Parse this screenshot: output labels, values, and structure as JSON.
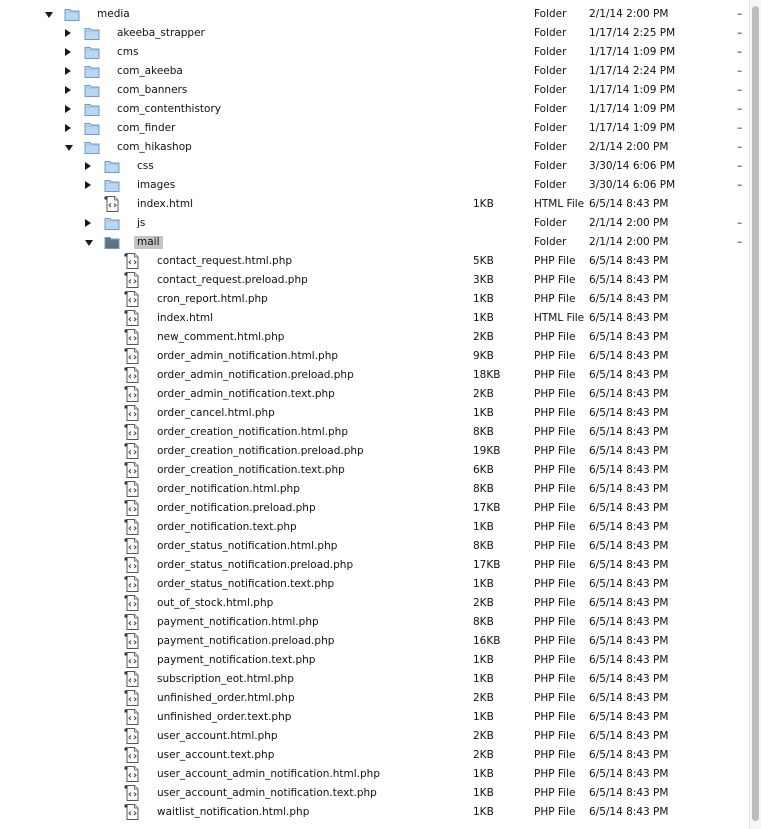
{
  "rows": [
    {
      "depth": 0,
      "disclosure": "open",
      "icon": "folder-icon",
      "name": "media",
      "size": "",
      "kind": "Folder",
      "date": "2/1/14 2:00 PM",
      "extra": "–"
    },
    {
      "depth": 1,
      "disclosure": "closed",
      "icon": "folder-icon",
      "name": "akeeba_strapper",
      "size": "",
      "kind": "Folder",
      "date": "1/17/14 2:25 PM",
      "extra": "–"
    },
    {
      "depth": 1,
      "disclosure": "closed",
      "icon": "folder-icon",
      "name": "cms",
      "size": "",
      "kind": "Folder",
      "date": "1/17/14 1:09 PM",
      "extra": "–"
    },
    {
      "depth": 1,
      "disclosure": "closed",
      "icon": "folder-icon",
      "name": "com_akeeba",
      "size": "",
      "kind": "Folder",
      "date": "1/17/14 2:24 PM",
      "extra": "–"
    },
    {
      "depth": 1,
      "disclosure": "closed",
      "icon": "folder-icon",
      "name": "com_banners",
      "size": "",
      "kind": "Folder",
      "date": "1/17/14 1:09 PM",
      "extra": "–"
    },
    {
      "depth": 1,
      "disclosure": "closed",
      "icon": "folder-icon",
      "name": "com_contenthistory",
      "size": "",
      "kind": "Folder",
      "date": "1/17/14 1:09 PM",
      "extra": "–"
    },
    {
      "depth": 1,
      "disclosure": "closed",
      "icon": "folder-icon",
      "name": "com_finder",
      "size": "",
      "kind": "Folder",
      "date": "1/17/14 1:09 PM",
      "extra": "–"
    },
    {
      "depth": 1,
      "disclosure": "open",
      "icon": "folder-icon",
      "name": "com_hikashop",
      "size": "",
      "kind": "Folder",
      "date": "2/1/14 2:00 PM",
      "extra": "–"
    },
    {
      "depth": 2,
      "disclosure": "closed",
      "icon": "folder-icon",
      "name": "css",
      "size": "",
      "kind": "Folder",
      "date": "3/30/14 6:06 PM",
      "extra": "–"
    },
    {
      "depth": 2,
      "disclosure": "closed",
      "icon": "folder-icon",
      "name": "images",
      "size": "",
      "kind": "Folder",
      "date": "3/30/14 6:06 PM",
      "extra": "–"
    },
    {
      "depth": 2,
      "disclosure": "none",
      "icon": "html-file-icon",
      "name": "index.html",
      "size": "1KB",
      "kind": "HTML File",
      "date": "6/5/14 8:43 PM",
      "extra": ""
    },
    {
      "depth": 2,
      "disclosure": "closed",
      "icon": "folder-icon",
      "name": "js",
      "size": "",
      "kind": "Folder",
      "date": "2/1/14 2:00 PM",
      "extra": "–"
    },
    {
      "depth": 2,
      "disclosure": "open",
      "icon": "folder-selected-icon",
      "name": "mail",
      "size": "",
      "kind": "Folder",
      "date": "2/1/14 2:00 PM",
      "extra": "–",
      "selected": true
    },
    {
      "depth": 3,
      "disclosure": "none",
      "icon": "php-file-icon",
      "name": "contact_request.html.php",
      "size": "5KB",
      "kind": "PHP File",
      "date": "6/5/14 8:43 PM",
      "extra": ""
    },
    {
      "depth": 3,
      "disclosure": "none",
      "icon": "php-file-icon",
      "name": "contact_request.preload.php",
      "size": "3KB",
      "kind": "PHP File",
      "date": "6/5/14 8:43 PM",
      "extra": ""
    },
    {
      "depth": 3,
      "disclosure": "none",
      "icon": "php-file-icon",
      "name": "cron_report.html.php",
      "size": "1KB",
      "kind": "PHP File",
      "date": "6/5/14 8:43 PM",
      "extra": ""
    },
    {
      "depth": 3,
      "disclosure": "none",
      "icon": "html-file-icon",
      "name": "index.html",
      "size": "1KB",
      "kind": "HTML File",
      "date": "6/5/14 8:43 PM",
      "extra": ""
    },
    {
      "depth": 3,
      "disclosure": "none",
      "icon": "php-file-icon",
      "name": "new_comment.html.php",
      "size": "2KB",
      "kind": "PHP File",
      "date": "6/5/14 8:43 PM",
      "extra": ""
    },
    {
      "depth": 3,
      "disclosure": "none",
      "icon": "php-file-icon",
      "name": "order_admin_notification.html.php",
      "size": "9KB",
      "kind": "PHP File",
      "date": "6/5/14 8:43 PM",
      "extra": ""
    },
    {
      "depth": 3,
      "disclosure": "none",
      "icon": "php-file-icon",
      "name": "order_admin_notification.preload.php",
      "size": "18KB",
      "kind": "PHP File",
      "date": "6/5/14 8:43 PM",
      "extra": ""
    },
    {
      "depth": 3,
      "disclosure": "none",
      "icon": "php-file-icon",
      "name": "order_admin_notification.text.php",
      "size": "2KB",
      "kind": "PHP File",
      "date": "6/5/14 8:43 PM",
      "extra": ""
    },
    {
      "depth": 3,
      "disclosure": "none",
      "icon": "php-file-icon",
      "name": "order_cancel.html.php",
      "size": "1KB",
      "kind": "PHP File",
      "date": "6/5/14 8:43 PM",
      "extra": ""
    },
    {
      "depth": 3,
      "disclosure": "none",
      "icon": "php-file-icon",
      "name": "order_creation_notification.html.php",
      "size": "8KB",
      "kind": "PHP File",
      "date": "6/5/14 8:43 PM",
      "extra": ""
    },
    {
      "depth": 3,
      "disclosure": "none",
      "icon": "php-file-icon",
      "name": "order_creation_notification.preload.php",
      "size": "19KB",
      "kind": "PHP File",
      "date": "6/5/14 8:43 PM",
      "extra": ""
    },
    {
      "depth": 3,
      "disclosure": "none",
      "icon": "php-file-icon",
      "name": "order_creation_notification.text.php",
      "size": "6KB",
      "kind": "PHP File",
      "date": "6/5/14 8:43 PM",
      "extra": ""
    },
    {
      "depth": 3,
      "disclosure": "none",
      "icon": "php-file-icon",
      "name": "order_notification.html.php",
      "size": "8KB",
      "kind": "PHP File",
      "date": "6/5/14 8:43 PM",
      "extra": ""
    },
    {
      "depth": 3,
      "disclosure": "none",
      "icon": "php-file-icon",
      "name": "order_notification.preload.php",
      "size": "17KB",
      "kind": "PHP File",
      "date": "6/5/14 8:43 PM",
      "extra": ""
    },
    {
      "depth": 3,
      "disclosure": "none",
      "icon": "php-file-icon",
      "name": "order_notification.text.php",
      "size": "1KB",
      "kind": "PHP File",
      "date": "6/5/14 8:43 PM",
      "extra": ""
    },
    {
      "depth": 3,
      "disclosure": "none",
      "icon": "php-file-icon",
      "name": "order_status_notification.html.php",
      "size": "8KB",
      "kind": "PHP File",
      "date": "6/5/14 8:43 PM",
      "extra": ""
    },
    {
      "depth": 3,
      "disclosure": "none",
      "icon": "php-file-icon",
      "name": "order_status_notification.preload.php",
      "size": "17KB",
      "kind": "PHP File",
      "date": "6/5/14 8:43 PM",
      "extra": ""
    },
    {
      "depth": 3,
      "disclosure": "none",
      "icon": "php-file-icon",
      "name": "order_status_notification.text.php",
      "size": "1KB",
      "kind": "PHP File",
      "date": "6/5/14 8:43 PM",
      "extra": ""
    },
    {
      "depth": 3,
      "disclosure": "none",
      "icon": "php-file-icon",
      "name": "out_of_stock.html.php",
      "size": "2KB",
      "kind": "PHP File",
      "date": "6/5/14 8:43 PM",
      "extra": ""
    },
    {
      "depth": 3,
      "disclosure": "none",
      "icon": "php-file-icon",
      "name": "payment_notification.html.php",
      "size": "8KB",
      "kind": "PHP File",
      "date": "6/5/14 8:43 PM",
      "extra": ""
    },
    {
      "depth": 3,
      "disclosure": "none",
      "icon": "php-file-icon",
      "name": "payment_notification.preload.php",
      "size": "16KB",
      "kind": "PHP File",
      "date": "6/5/14 8:43 PM",
      "extra": ""
    },
    {
      "depth": 3,
      "disclosure": "none",
      "icon": "php-file-icon",
      "name": "payment_notification.text.php",
      "size": "1KB",
      "kind": "PHP File",
      "date": "6/5/14 8:43 PM",
      "extra": ""
    },
    {
      "depth": 3,
      "disclosure": "none",
      "icon": "php-file-icon",
      "name": "subscription_eot.html.php",
      "size": "1KB",
      "kind": "PHP File",
      "date": "6/5/14 8:43 PM",
      "extra": ""
    },
    {
      "depth": 3,
      "disclosure": "none",
      "icon": "php-file-icon",
      "name": "unfinished_order.html.php",
      "size": "2KB",
      "kind": "PHP File",
      "date": "6/5/14 8:43 PM",
      "extra": ""
    },
    {
      "depth": 3,
      "disclosure": "none",
      "icon": "php-file-icon",
      "name": "unfinished_order.text.php",
      "size": "1KB",
      "kind": "PHP File",
      "date": "6/5/14 8:43 PM",
      "extra": ""
    },
    {
      "depth": 3,
      "disclosure": "none",
      "icon": "php-file-icon",
      "name": "user_account.html.php",
      "size": "2KB",
      "kind": "PHP File",
      "date": "6/5/14 8:43 PM",
      "extra": ""
    },
    {
      "depth": 3,
      "disclosure": "none",
      "icon": "php-file-icon",
      "name": "user_account.text.php",
      "size": "2KB",
      "kind": "PHP File",
      "date": "6/5/14 8:43 PM",
      "extra": ""
    },
    {
      "depth": 3,
      "disclosure": "none",
      "icon": "php-file-icon",
      "name": "user_account_admin_notification.html.php",
      "size": "1KB",
      "kind": "PHP File",
      "date": "6/5/14 8:43 PM",
      "extra": ""
    },
    {
      "depth": 3,
      "disclosure": "none",
      "icon": "php-file-icon",
      "name": "user_account_admin_notification.text.php",
      "size": "1KB",
      "kind": "PHP File",
      "date": "6/5/14 8:43 PM",
      "extra": ""
    },
    {
      "depth": 3,
      "disclosure": "none",
      "icon": "php-file-icon",
      "name": "waitlist_notification.html.php",
      "size": "1KB",
      "kind": "PHP File",
      "date": "6/5/14 8:43 PM",
      "extra": ""
    }
  ],
  "colors": {
    "folder_fill": "#b9d6f2",
    "folder_stroke": "#6f9bc6",
    "folder_selected_fill": "#5f6f80",
    "selection": "#c4c4c4",
    "scroll_thumb": "#bdbdbd"
  }
}
